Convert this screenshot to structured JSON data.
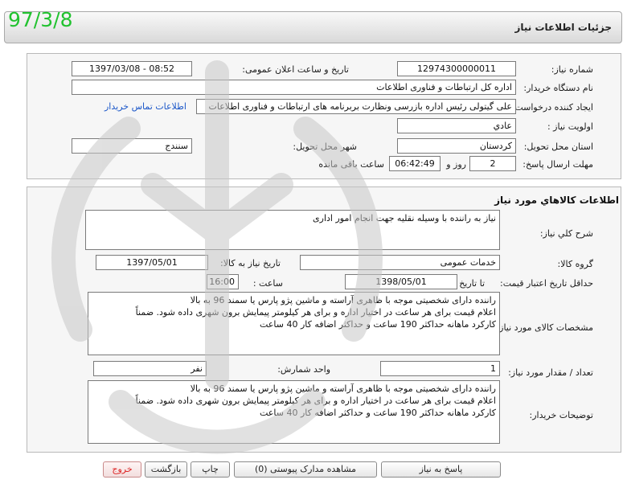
{
  "stamp": {
    "date": "97/3/8"
  },
  "header": {
    "title": "جزئیات اطلاعات نیاز"
  },
  "details": {
    "need_number_label": "شماره نیاز:",
    "need_number": "12974300000011",
    "announce_datetime_label": "تاریخ و ساعت اعلان عمومی:",
    "announce_datetime": "1397/03/08 - 08:52",
    "buyer_org_label": "نام دستگاه خریدار:",
    "buyer_org": "اداره کل ارتباطات و فناوری اطلاعات",
    "requester_label": "ایجاد کننده درخواست:",
    "requester": "علی گیتولی رئیس اداره بازرسی ونظارت بربرنامه های ارتباطات و فناوری اطلاعات",
    "contact_link": "اطلاعات تماس خریدار",
    "priority_label": "اولویت نیاز :",
    "priority": "عادي",
    "province_label": "استان محل تحویل:",
    "province": "کردستان",
    "city_label": "شهر محل تحویل:",
    "city": "سنندج",
    "deadline_label": "مهلت ارسال پاسخ:",
    "days": "2",
    "days_word": "روز و",
    "time_left": "06:42:49",
    "time_left_suffix": "ساعت باقی مانده"
  },
  "goods": {
    "section_title": "اطلاعات کالاهاي مورد نياز",
    "summary_label": "شرح کلي نياز:",
    "summary": "نیاز به راننده با وسیله نقلیه جهت انجام امور اداری",
    "group_label": "گروه کالا:",
    "group": "خدمات عمومی",
    "need_date_label": "تاریخ نیاز به کالا:",
    "need_date": "1397/05/01",
    "validity_label": "حداقل تاریخ اعتبار قیمت:",
    "until_date_label": "تا تاریخ :",
    "until_date": "1398/05/01",
    "hour_label": "ساعت :",
    "hour": "16:00",
    "specs_label": "مشخصات کالای مورد نیاز:",
    "spec_lines": [
      "راننده دارای شخصیتی موجه با ظاهری آراسته و ماشین پژو پارس یا سمند 96 به بالا",
      "اعلام قیمت برای هر ساعت در اختیار اداره  و برای هر کیلومتر پیمایش برون شهری داده شود. ضمناً",
      "کارکرد ماهانه حداکثر  190 ساعت و حداکثر اضافه کار 40 ساعت"
    ],
    "qty_label": "تعداد / مقدار مورد نیاز:",
    "qty": "1",
    "unit_label": "واحد شمارش:",
    "unit": "نفر",
    "notes_label": "توضیحات خریدار:",
    "note_lines": [
      "راننده دارای شخصیتی موجه با ظاهری آراسته و ماشین پژو پارس یا سمند 96 به بالا",
      "اعلام قیمت برای هر ساعت در اختیار اداره  و برای هر کیلومتر پیمایش برون شهری داده شود. ضمناً",
      "کارکرد ماهانه حداکثر  190 ساعت و حداکثر اضافه کار 40 ساعت"
    ]
  },
  "buttons": {
    "reply": "پاسخ به نیاز",
    "attachments": "مشاهده مدارک پیوستی (0)",
    "print": "چاپ",
    "back": "بازگشت",
    "exit": "خروج"
  },
  "colors": {
    "stamp": "#22c230",
    "link": "#1a56c8",
    "exit_text": "#dd2222"
  }
}
